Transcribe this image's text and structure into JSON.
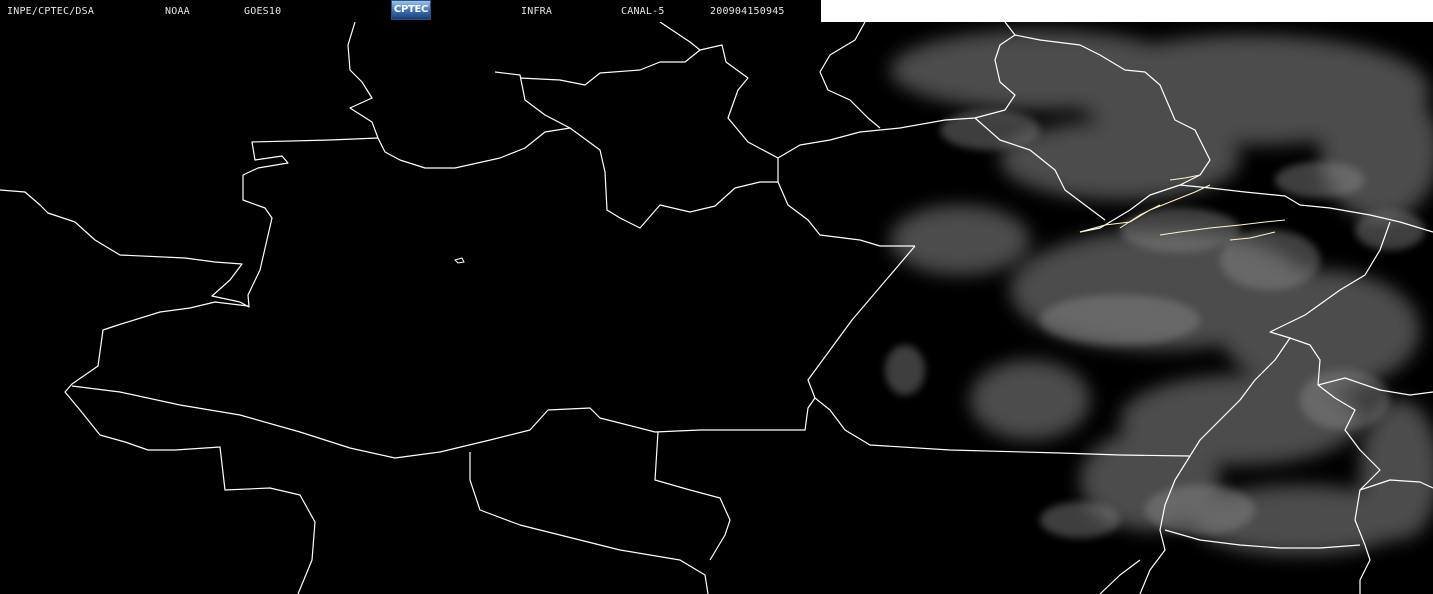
{
  "header": {
    "source": "INPE/CPTEC/DSA",
    "agency": "NOAA",
    "satellite": "GOES10",
    "logo_text": "CPTEC",
    "product": "INFRA",
    "channel": "CANAL-5",
    "timestamp": "200904150945"
  },
  "colors": {
    "background": "#000000",
    "border_lines": "#ffffff",
    "river_lines": "#fff4c0",
    "cloud_gray": "#8a8a8a",
    "header_blank": "#ffffff"
  },
  "map": {
    "type": "satellite infrared image",
    "layers": [
      "cloud-cover",
      "state-borders",
      "rivers"
    ]
  }
}
